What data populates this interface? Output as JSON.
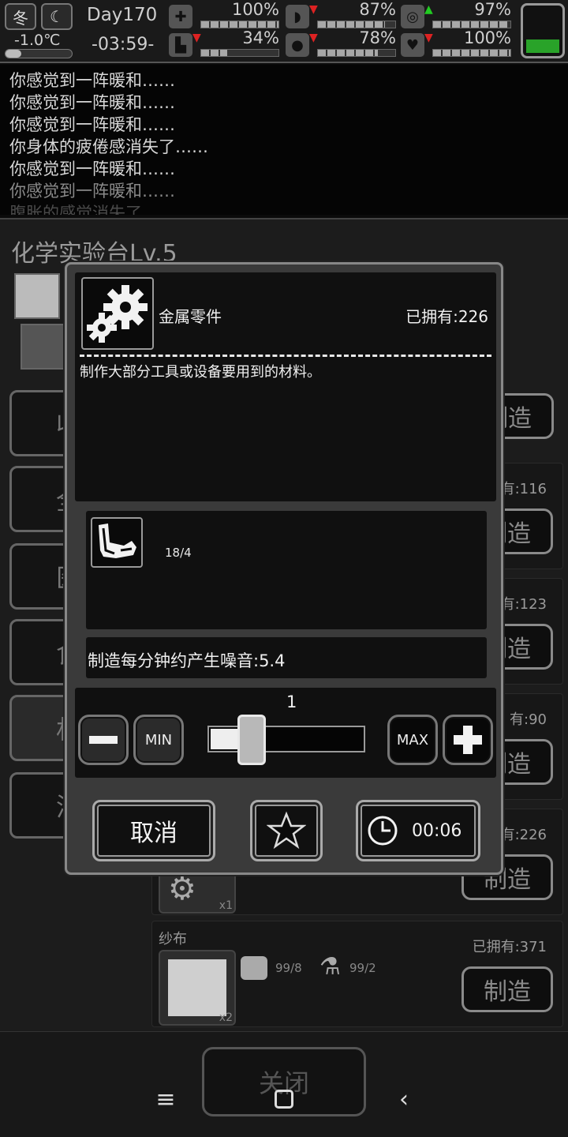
{
  "status": {
    "season": "冬",
    "temperature": "-1.0℃",
    "day": "Day170",
    "time": "-03:59-",
    "stats": [
      {
        "icon": "medkit-icon",
        "glyph": "✚",
        "value": "100%",
        "level": 1.0,
        "arrow": ""
      },
      {
        "icon": "stomach-icon",
        "glyph": "◗",
        "value": "87%",
        "level": 0.87,
        "arrow": "down"
      },
      {
        "icon": "pill-icon",
        "glyph": "◎",
        "value": "97%",
        "level": 0.97,
        "arrow": "up"
      },
      {
        "icon": "boot-icon",
        "glyph": "▙",
        "value": "34%",
        "level": 0.34,
        "arrow": "down"
      },
      {
        "icon": "water-drop-icon",
        "glyph": "●",
        "value": "78%",
        "level": 0.78,
        "arrow": "down"
      },
      {
        "icon": "heart-icon",
        "glyph": "♥",
        "value": "100%",
        "level": 1.0,
        "arrow": "down"
      }
    ],
    "battery_level": 0.3
  },
  "log": [
    "你感觉到一阵暖和……",
    "你感觉到一阵暖和……",
    "你感觉到一阵暖和……",
    "你身体的疲倦感消失了……",
    "你感觉到一阵暖和……",
    "你感觉到一阵暖和……",
    "腹胀的感觉消失了……"
  ],
  "bench": {
    "title": "化学实验台Lv.5",
    "categories": [
      "收",
      "全",
      "医",
      "食",
      "材",
      "消"
    ]
  },
  "rows": [
    {
      "owned": "有:116",
      "make": "制造"
    },
    {
      "owned": "有:123",
      "make": "制造"
    },
    {
      "owned": "有:90",
      "make": "制造"
    },
    {
      "owned": "有:226",
      "make": "制造",
      "qty": "x1"
    },
    {
      "name": "纱布",
      "owned": "已拥有:371",
      "make": "制造",
      "qty": "x2",
      "mats": [
        "99/8",
        "99/2"
      ]
    }
  ],
  "top_make": "制造",
  "modal": {
    "item_name": "金属零件",
    "owned": "已拥有:226",
    "description": "制作大部分工具或设备要用到的材料。",
    "material_count": "18/4",
    "noise": "制造每分钟约产生噪音:5.4",
    "quantity": "1",
    "quantity_fraction": 0.06,
    "min_label": "MIN",
    "max_label": "MAX",
    "cancel_label": "取消",
    "craft_time": "00:06"
  },
  "close_label": "关闭"
}
